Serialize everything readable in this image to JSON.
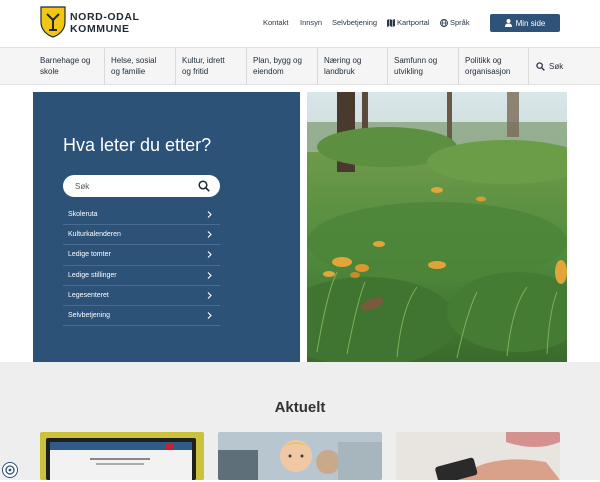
{
  "header": {
    "logo_line1": "NORD-ODAL",
    "logo_line2": "KOMMUNE",
    "links": [
      "Kontakt",
      "Innsyn",
      "Selvbetjening",
      "Kartportal",
      "Språk"
    ],
    "min_side": "Min side"
  },
  "nav": {
    "items": [
      {
        "line1": "Barnehage og",
        "line2": "skole"
      },
      {
        "line1": "Helse, sosial",
        "line2": "og familie"
      },
      {
        "line1": "Kultur, idrett",
        "line2": "og fritid"
      },
      {
        "line1": "Plan, bygg og",
        "line2": "eiendom"
      },
      {
        "line1": "Næring og",
        "line2": "landbruk"
      },
      {
        "line1": "Samfunn og",
        "line2": "utvikling"
      },
      {
        "line1": "Politikk og",
        "line2": "organisasjon"
      }
    ],
    "search_label": "Søk"
  },
  "hero": {
    "title": "Hva leter du etter?",
    "search_placeholder": "Søk",
    "quick_links": [
      "Skoleruta",
      "Kulturkalenderen",
      "Ledige tomter",
      "Ledige stillinger",
      "Legesenteret",
      "Selvbetjening"
    ]
  },
  "news": {
    "title": "Aktuelt"
  },
  "colors": {
    "brand_blue": "#2c5278",
    "button_blue": "#2f5278",
    "logo_yellow": "#f3c613"
  }
}
